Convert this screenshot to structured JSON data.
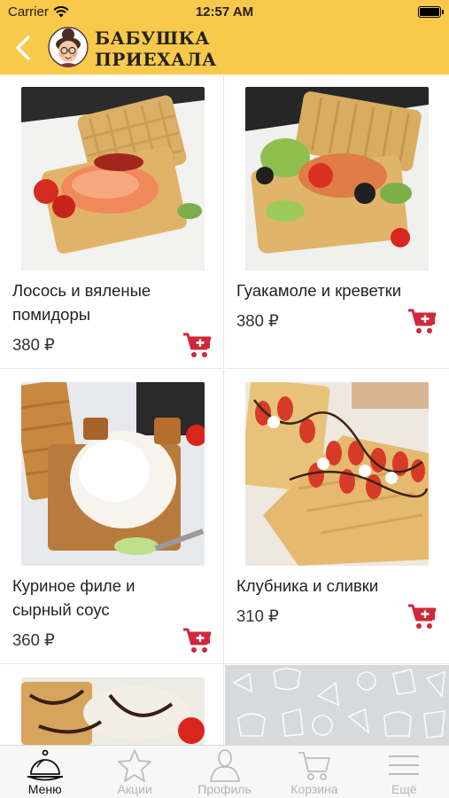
{
  "status_bar": {
    "carrier": "Carrier",
    "time": "12:57 AM"
  },
  "header": {
    "brand_line1": "БАБУШКА",
    "brand_line2": "ПРИЕХАЛА"
  },
  "products": [
    {
      "name": "Лосось и вяленые помидоры",
      "price": "380 ₽"
    },
    {
      "name": "Гуакамоле и креветки",
      "price": "380 ₽"
    },
    {
      "name": "Куриное филе и сырный соус",
      "price": "360 ₽"
    },
    {
      "name": "Клубника и сливки",
      "price": "310 ₽"
    }
  ],
  "tabbar": {
    "active": "menu",
    "items": [
      {
        "label": "Меню",
        "icon": "cloche-icon"
      },
      {
        "label": "Акции",
        "icon": "star-icon"
      },
      {
        "label": "Профиль",
        "icon": "profile-icon"
      },
      {
        "label": "Корзина",
        "icon": "cart-icon"
      },
      {
        "label": "Ещё",
        "icon": "menu-lines-icon"
      }
    ]
  },
  "colors": {
    "header_bg": "#f8c94a",
    "accent_red": "#d0283a",
    "tab_inactive": "#b5b5b5"
  }
}
